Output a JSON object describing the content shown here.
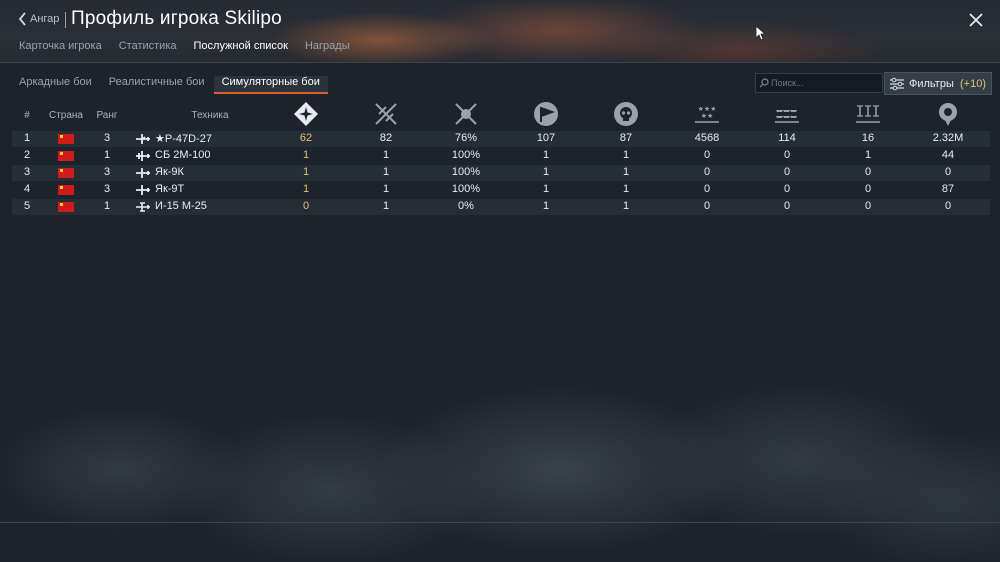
{
  "header": {
    "back_label": "Ангар",
    "title": "Профиль игрока Skilipo"
  },
  "main_tabs": [
    {
      "label": "Карточка игрока",
      "active": false
    },
    {
      "label": "Статистика",
      "active": false
    },
    {
      "label": "Послужной список",
      "active": true
    },
    {
      "label": "Награды",
      "active": false
    }
  ],
  "mode_tabs": [
    {
      "label": "Аркадные бои",
      "active": false
    },
    {
      "label": "Реалистичные бои",
      "active": false
    },
    {
      "label": "Симуляторные бои",
      "active": true
    }
  ],
  "search": {
    "placeholder": "Поиск..."
  },
  "filters": {
    "label": "Фильтры",
    "count": "(+10)"
  },
  "columns": {
    "num": "#",
    "country": "Страна",
    "rank": "Ранг",
    "vehicle": "Техника",
    "icons": [
      "aces-icon",
      "battles-icon",
      "victories-icon",
      "flag-icon",
      "skull-icon",
      "air-kills-icon",
      "ground-kills-icon",
      "naval-kills-icon",
      "score-icon"
    ]
  },
  "accent_color": "#e3c46a",
  "rows": [
    {
      "num": "1",
      "rank": "3",
      "vehicle": "★P-47D-27",
      "c1": "62",
      "c2": "82",
      "c3": "76%",
      "c4": "107",
      "c5": "87",
      "c6": "4568",
      "c7": "114",
      "c8": "16",
      "c9": "2.32M"
    },
    {
      "num": "2",
      "rank": "1",
      "vehicle": "СБ 2М-100",
      "c1": "1",
      "c2": "1",
      "c3": "100%",
      "c4": "1",
      "c5": "1",
      "c6": "0",
      "c7": "0",
      "c8": "1",
      "c9": "44"
    },
    {
      "num": "3",
      "rank": "3",
      "vehicle": "Як-9К",
      "c1": "1",
      "c2": "1",
      "c3": "100%",
      "c4": "1",
      "c5": "1",
      "c6": "0",
      "c7": "0",
      "c8": "0",
      "c9": "0"
    },
    {
      "num": "4",
      "rank": "3",
      "vehicle": "Як-9Т",
      "c1": "1",
      "c2": "1",
      "c3": "100%",
      "c4": "1",
      "c5": "1",
      "c6": "0",
      "c7": "0",
      "c8": "0",
      "c9": "87"
    },
    {
      "num": "5",
      "rank": "1",
      "vehicle": "И-15 М-25",
      "c1": "0",
      "c2": "1",
      "c3": "0%",
      "c4": "1",
      "c5": "1",
      "c6": "0",
      "c7": "0",
      "c8": "0",
      "c9": "0"
    }
  ]
}
